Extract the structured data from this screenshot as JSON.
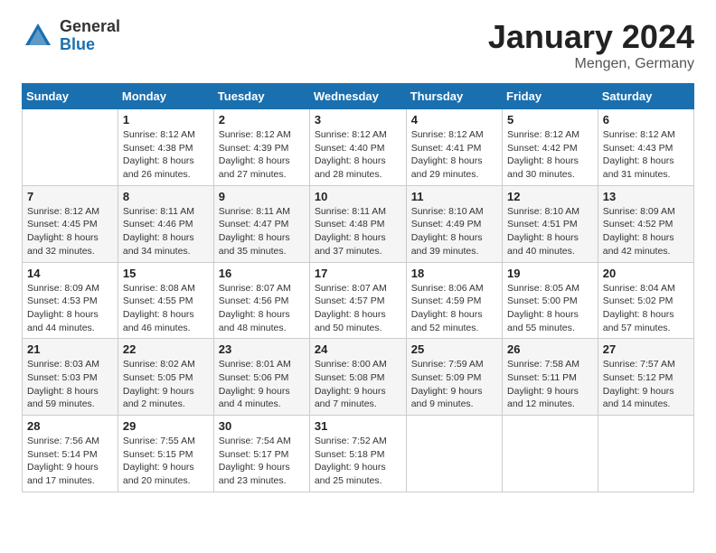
{
  "header": {
    "logo": {
      "general": "General",
      "blue": "Blue"
    },
    "title": "January 2024",
    "location": "Mengen, Germany"
  },
  "weekdays": [
    "Sunday",
    "Monday",
    "Tuesday",
    "Wednesday",
    "Thursday",
    "Friday",
    "Saturday"
  ],
  "weeks": [
    [
      {
        "day": null,
        "sunrise": null,
        "sunset": null,
        "daylight": null
      },
      {
        "day": "1",
        "sunrise": "Sunrise: 8:12 AM",
        "sunset": "Sunset: 4:38 PM",
        "daylight": "Daylight: 8 hours and 26 minutes."
      },
      {
        "day": "2",
        "sunrise": "Sunrise: 8:12 AM",
        "sunset": "Sunset: 4:39 PM",
        "daylight": "Daylight: 8 hours and 27 minutes."
      },
      {
        "day": "3",
        "sunrise": "Sunrise: 8:12 AM",
        "sunset": "Sunset: 4:40 PM",
        "daylight": "Daylight: 8 hours and 28 minutes."
      },
      {
        "day": "4",
        "sunrise": "Sunrise: 8:12 AM",
        "sunset": "Sunset: 4:41 PM",
        "daylight": "Daylight: 8 hours and 29 minutes."
      },
      {
        "day": "5",
        "sunrise": "Sunrise: 8:12 AM",
        "sunset": "Sunset: 4:42 PM",
        "daylight": "Daylight: 8 hours and 30 minutes."
      },
      {
        "day": "6",
        "sunrise": "Sunrise: 8:12 AM",
        "sunset": "Sunset: 4:43 PM",
        "daylight": "Daylight: 8 hours and 31 minutes."
      }
    ],
    [
      {
        "day": "7",
        "sunrise": "Sunrise: 8:12 AM",
        "sunset": "Sunset: 4:45 PM",
        "daylight": "Daylight: 8 hours and 32 minutes."
      },
      {
        "day": "8",
        "sunrise": "Sunrise: 8:11 AM",
        "sunset": "Sunset: 4:46 PM",
        "daylight": "Daylight: 8 hours and 34 minutes."
      },
      {
        "day": "9",
        "sunrise": "Sunrise: 8:11 AM",
        "sunset": "Sunset: 4:47 PM",
        "daylight": "Daylight: 8 hours and 35 minutes."
      },
      {
        "day": "10",
        "sunrise": "Sunrise: 8:11 AM",
        "sunset": "Sunset: 4:48 PM",
        "daylight": "Daylight: 8 hours and 37 minutes."
      },
      {
        "day": "11",
        "sunrise": "Sunrise: 8:10 AM",
        "sunset": "Sunset: 4:49 PM",
        "daylight": "Daylight: 8 hours and 39 minutes."
      },
      {
        "day": "12",
        "sunrise": "Sunrise: 8:10 AM",
        "sunset": "Sunset: 4:51 PM",
        "daylight": "Daylight: 8 hours and 40 minutes."
      },
      {
        "day": "13",
        "sunrise": "Sunrise: 8:09 AM",
        "sunset": "Sunset: 4:52 PM",
        "daylight": "Daylight: 8 hours and 42 minutes."
      }
    ],
    [
      {
        "day": "14",
        "sunrise": "Sunrise: 8:09 AM",
        "sunset": "Sunset: 4:53 PM",
        "daylight": "Daylight: 8 hours and 44 minutes."
      },
      {
        "day": "15",
        "sunrise": "Sunrise: 8:08 AM",
        "sunset": "Sunset: 4:55 PM",
        "daylight": "Daylight: 8 hours and 46 minutes."
      },
      {
        "day": "16",
        "sunrise": "Sunrise: 8:07 AM",
        "sunset": "Sunset: 4:56 PM",
        "daylight": "Daylight: 8 hours and 48 minutes."
      },
      {
        "day": "17",
        "sunrise": "Sunrise: 8:07 AM",
        "sunset": "Sunset: 4:57 PM",
        "daylight": "Daylight: 8 hours and 50 minutes."
      },
      {
        "day": "18",
        "sunrise": "Sunrise: 8:06 AM",
        "sunset": "Sunset: 4:59 PM",
        "daylight": "Daylight: 8 hours and 52 minutes."
      },
      {
        "day": "19",
        "sunrise": "Sunrise: 8:05 AM",
        "sunset": "Sunset: 5:00 PM",
        "daylight": "Daylight: 8 hours and 55 minutes."
      },
      {
        "day": "20",
        "sunrise": "Sunrise: 8:04 AM",
        "sunset": "Sunset: 5:02 PM",
        "daylight": "Daylight: 8 hours and 57 minutes."
      }
    ],
    [
      {
        "day": "21",
        "sunrise": "Sunrise: 8:03 AM",
        "sunset": "Sunset: 5:03 PM",
        "daylight": "Daylight: 8 hours and 59 minutes."
      },
      {
        "day": "22",
        "sunrise": "Sunrise: 8:02 AM",
        "sunset": "Sunset: 5:05 PM",
        "daylight": "Daylight: 9 hours and 2 minutes."
      },
      {
        "day": "23",
        "sunrise": "Sunrise: 8:01 AM",
        "sunset": "Sunset: 5:06 PM",
        "daylight": "Daylight: 9 hours and 4 minutes."
      },
      {
        "day": "24",
        "sunrise": "Sunrise: 8:00 AM",
        "sunset": "Sunset: 5:08 PM",
        "daylight": "Daylight: 9 hours and 7 minutes."
      },
      {
        "day": "25",
        "sunrise": "Sunrise: 7:59 AM",
        "sunset": "Sunset: 5:09 PM",
        "daylight": "Daylight: 9 hours and 9 minutes."
      },
      {
        "day": "26",
        "sunrise": "Sunrise: 7:58 AM",
        "sunset": "Sunset: 5:11 PM",
        "daylight": "Daylight: 9 hours and 12 minutes."
      },
      {
        "day": "27",
        "sunrise": "Sunrise: 7:57 AM",
        "sunset": "Sunset: 5:12 PM",
        "daylight": "Daylight: 9 hours and 14 minutes."
      }
    ],
    [
      {
        "day": "28",
        "sunrise": "Sunrise: 7:56 AM",
        "sunset": "Sunset: 5:14 PM",
        "daylight": "Daylight: 9 hours and 17 minutes."
      },
      {
        "day": "29",
        "sunrise": "Sunrise: 7:55 AM",
        "sunset": "Sunset: 5:15 PM",
        "daylight": "Daylight: 9 hours and 20 minutes."
      },
      {
        "day": "30",
        "sunrise": "Sunrise: 7:54 AM",
        "sunset": "Sunset: 5:17 PM",
        "daylight": "Daylight: 9 hours and 23 minutes."
      },
      {
        "day": "31",
        "sunrise": "Sunrise: 7:52 AM",
        "sunset": "Sunset: 5:18 PM",
        "daylight": "Daylight: 9 hours and 25 minutes."
      },
      {
        "day": null,
        "sunrise": null,
        "sunset": null,
        "daylight": null
      },
      {
        "day": null,
        "sunrise": null,
        "sunset": null,
        "daylight": null
      },
      {
        "day": null,
        "sunrise": null,
        "sunset": null,
        "daylight": null
      }
    ]
  ]
}
